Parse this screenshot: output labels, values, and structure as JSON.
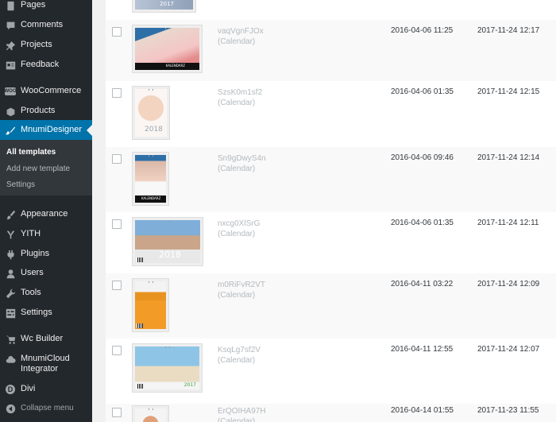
{
  "sidebar": {
    "items": [
      {
        "label": "Pages",
        "icon": "pages-icon"
      },
      {
        "label": "Comments",
        "icon": "comments-icon"
      },
      {
        "label": "Projects",
        "icon": "pin-icon"
      },
      {
        "label": "Feedback",
        "icon": "feedback-icon"
      },
      {
        "label": "WooCommerce",
        "icon": "woocommerce-icon"
      },
      {
        "label": "Products",
        "icon": "products-icon"
      },
      {
        "label": "MnumiDesigner",
        "icon": "designer-icon"
      },
      {
        "label": "Appearance",
        "icon": "brush-icon"
      },
      {
        "label": "YITH",
        "icon": "yith-icon"
      },
      {
        "label": "Plugins",
        "icon": "plugin-icon"
      },
      {
        "label": "Users",
        "icon": "users-icon"
      },
      {
        "label": "Tools",
        "icon": "wrench-icon"
      },
      {
        "label": "Settings",
        "icon": "settings-icon"
      },
      {
        "label": "Wc Builder",
        "icon": "cart-icon"
      },
      {
        "label": "MnumiCloud Integrator",
        "icon": "cloud-icon"
      },
      {
        "label": "Divi",
        "icon": "divi-icon"
      },
      {
        "label": "Collapse menu",
        "icon": "collapse-icon"
      }
    ],
    "submenu": [
      {
        "label": "All templates"
      },
      {
        "label": "Add new template"
      },
      {
        "label": "Settings"
      }
    ],
    "woo_badge": "WOO",
    "divi_letter": "D"
  },
  "templates": [
    {
      "name": "",
      "type": "",
      "created": "",
      "modified": "",
      "thumb_year": "2017"
    },
    {
      "name": "vaqVgnFJOx",
      "type": "(Calendar)",
      "created": "2016-04-06 11:25",
      "modified": "2017-11-24 12:17",
      "thumb_caption": "KALENDARZ"
    },
    {
      "name": "SzsK0m1sf2",
      "type": "(Calendar)",
      "created": "2016-04-06 01:35",
      "modified": "2017-11-24 12:15",
      "thumb_year": "2018"
    },
    {
      "name": "Sn9gDwyS4n",
      "type": "(Calendar)",
      "created": "2016-04-06 09:46",
      "modified": "2017-11-24 12:14",
      "thumb_caption": "KALENDARZ"
    },
    {
      "name": "nxcg0XlSrG",
      "type": "(Calendar)",
      "created": "2016-04-06 01:35",
      "modified": "2017-11-24 12:11",
      "thumb_year": "2018"
    },
    {
      "name": "m0RiFvR2VT",
      "type": "(Calendar)",
      "created": "2016-04-11 03:22",
      "modified": "2017-11-24 12:09"
    },
    {
      "name": "KsqLg7sf2V",
      "type": "(Calendar)",
      "created": "2016-04-11 12:55",
      "modified": "2017-11-24 12:07",
      "thumb_year": "2017"
    },
    {
      "name": "ErQOIHA97H",
      "type": "(Calendar)",
      "created": "2016-04-14 01:55",
      "modified": "2017-11-23 11:55"
    }
  ],
  "colors": {
    "sidebar_bg": "#23282d",
    "accent": "#0073aa",
    "submenu_bg": "#32373c"
  }
}
